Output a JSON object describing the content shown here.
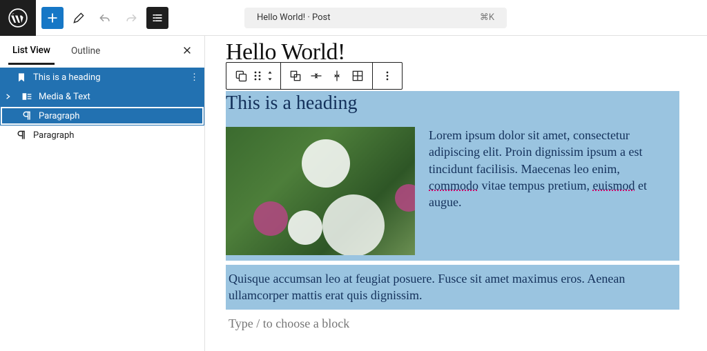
{
  "topbar": {
    "doc_title": "Hello World! · Post",
    "shortcut": "⌘K"
  },
  "sidebar": {
    "tabs": {
      "list_view": "List View",
      "outline": "Outline"
    }
  },
  "list_view": {
    "items": [
      {
        "label": "This is a heading",
        "icon": "bookmark"
      },
      {
        "label": "Media & Text",
        "icon": "media-text"
      },
      {
        "label": "Paragraph",
        "icon": "paragraph"
      },
      {
        "label": "Paragraph",
        "icon": "paragraph"
      }
    ]
  },
  "post": {
    "title": "Hello World!",
    "heading": "This is a heading",
    "media_text_paragraph": "Lorem ipsum dolor sit amet, consectetur adipiscing elit. Proin dignissim ipsum a est tincidunt facilisis. Maecenas leo enim, ",
    "media_text_word1": "commodo",
    "media_text_mid": " vitae tempus pretium, ",
    "media_text_word2": "euismod",
    "media_text_end": " et augue.",
    "paragraph2": "Quisque accumsan leo at feugiat posuere. Fusce sit amet maximus eros. Aenean ullamcorper mattis erat quis dignissim.",
    "placeholder": "Type / to choose a block"
  },
  "colors": {
    "selection_bg": "#9ac4e0",
    "wp_blue": "#2271b1",
    "text_dark_blue": "#13305a"
  }
}
